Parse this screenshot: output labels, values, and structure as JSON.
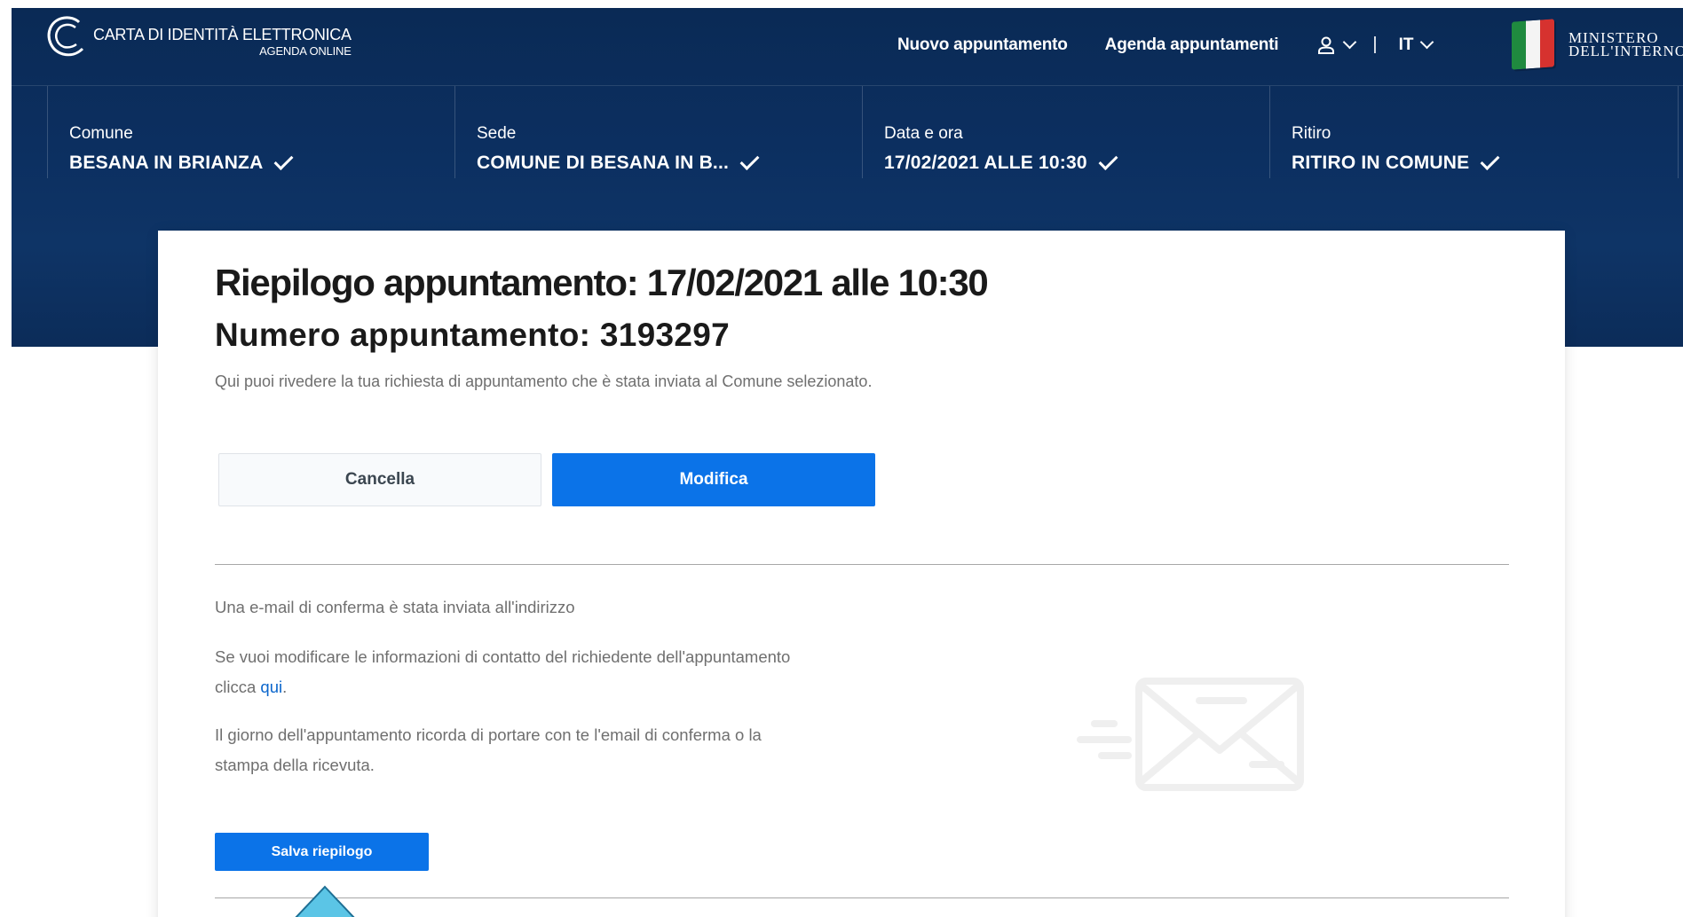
{
  "header": {
    "logo_title": "CARTA DI IDENTITÀ ELETTRONICA",
    "logo_subtitle": "AGENDA ONLINE",
    "nav_new": "Nuovo appuntamento",
    "nav_agenda": "Agenda appuntamenti",
    "user_icon": "user-icon",
    "separator": "|",
    "language": "IT",
    "ministry_line1": "MINISTERO",
    "ministry_line2": "DELL'INTERNO"
  },
  "steps": [
    {
      "label": "Comune",
      "value": "BESANA IN BRIANZA"
    },
    {
      "label": "Sede",
      "value": "COMUNE DI BESANA IN B..."
    },
    {
      "label": "Data e ora",
      "value": "17/02/2021 ALLE 10:30"
    },
    {
      "label": "Ritiro",
      "value": "RITIRO IN COMUNE"
    }
  ],
  "summary": {
    "title": "Riepilogo appuntamento: 17/02/2021 alle 10:30",
    "number": "Numero appuntamento: 3193297",
    "subtitle": "Qui puoi rivedere la tua richiesta di appuntamento che è stata inviata al Comune selezionato.",
    "cancel_label": "Cancella",
    "modify_label": "Modifica",
    "email_sent": "Una e-mail di conferma è stata inviata all'indirizzo",
    "contact_text_1": "Se vuoi modificare le informazioni di contatto del richiedente dell'appuntamento",
    "contact_text_2": "clicca ",
    "contact_link": "qui",
    "contact_text_3": ".",
    "reminder_1": "Il giorno dell'appuntamento ricorda di portare con te l'email di conferma o la",
    "reminder_2": "stampa della ricevuta.",
    "save_label": "Salva riepilogo"
  },
  "colors": {
    "hero": "#0c2f60",
    "primary_button": "#0b73e8",
    "text_muted": "#6f6f6f",
    "pointer": "#5bc5e6"
  }
}
